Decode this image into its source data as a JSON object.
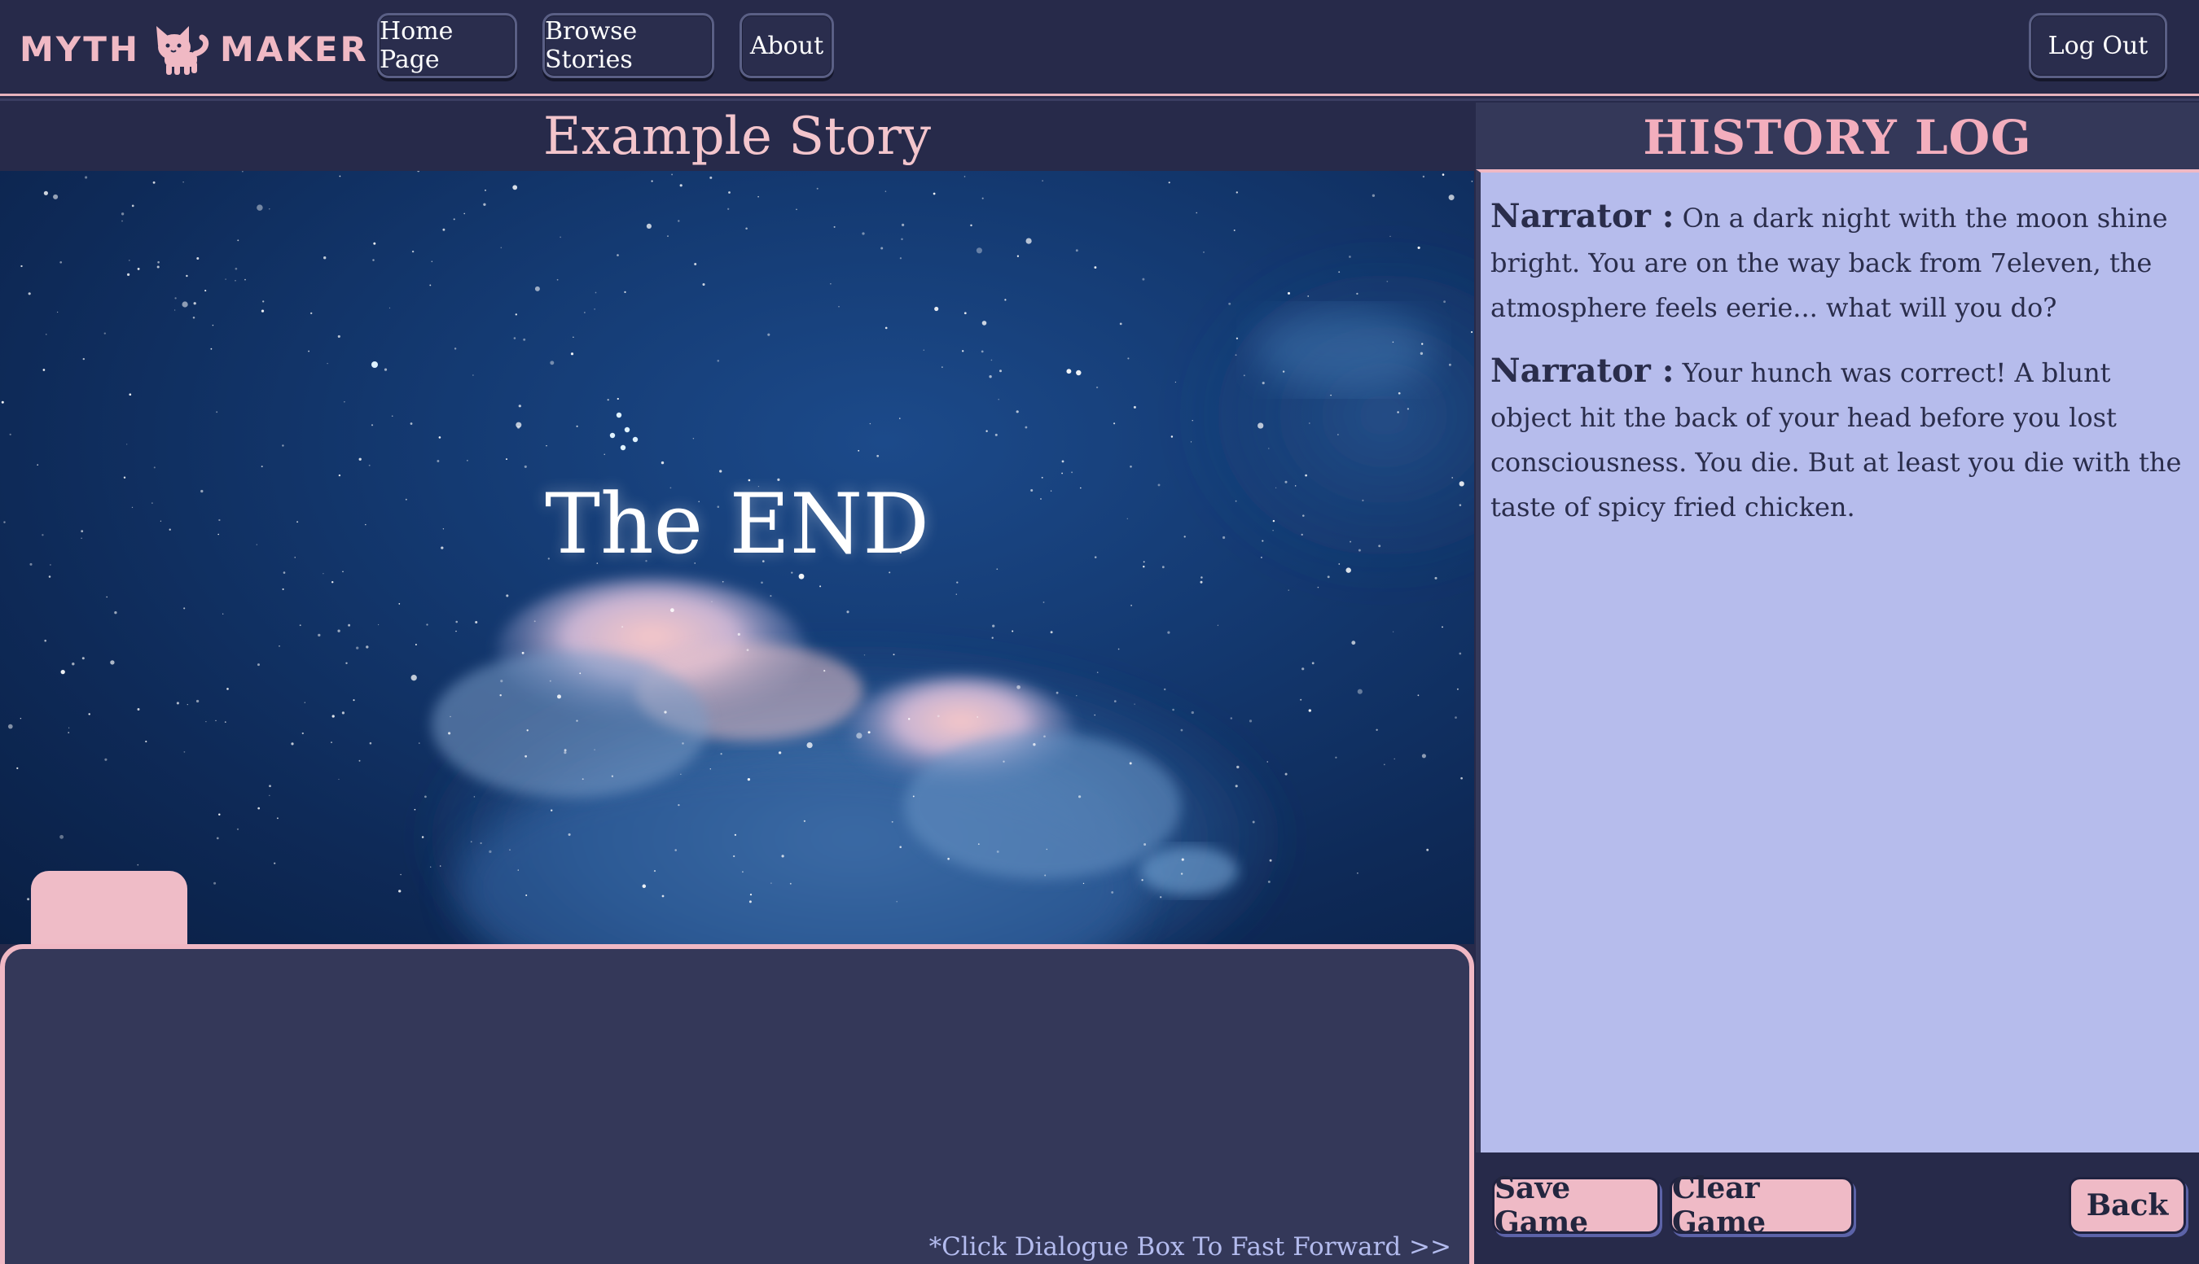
{
  "brand": {
    "left": "MYTH",
    "right": "MAKER",
    "logo_icon": "cat-icon"
  },
  "nav": {
    "home_label": "Home Page",
    "browse_label": "Browse Stories",
    "about_label": "About",
    "logout_label": "Log Out"
  },
  "story": {
    "title": "Example Story",
    "end_text": "The END",
    "fast_forward_hint": "*Click Dialogue Box To Fast Forward >>"
  },
  "history": {
    "title": "HISTORY LOG",
    "entries": [
      {
        "speaker": "Narrator :",
        "text": "On a dark night with the moon shine bright. You are on the way back from 7eleven, the atmosphere feels eerie... what will you do?"
      },
      {
        "speaker": "Narrator :",
        "text": "Your hunch was correct! A blunt object hit the back of your head before you lost consciousness. You die. But at least you die with the taste of spicy fried chicken."
      }
    ],
    "save_label": "Save Game",
    "clear_label": "Clear Game",
    "back_label": "Back"
  },
  "colors": {
    "background": "#272a4a",
    "accent_pink": "#efbac6",
    "log_background": "#b6bcec",
    "dialogue_background": "#343859"
  }
}
